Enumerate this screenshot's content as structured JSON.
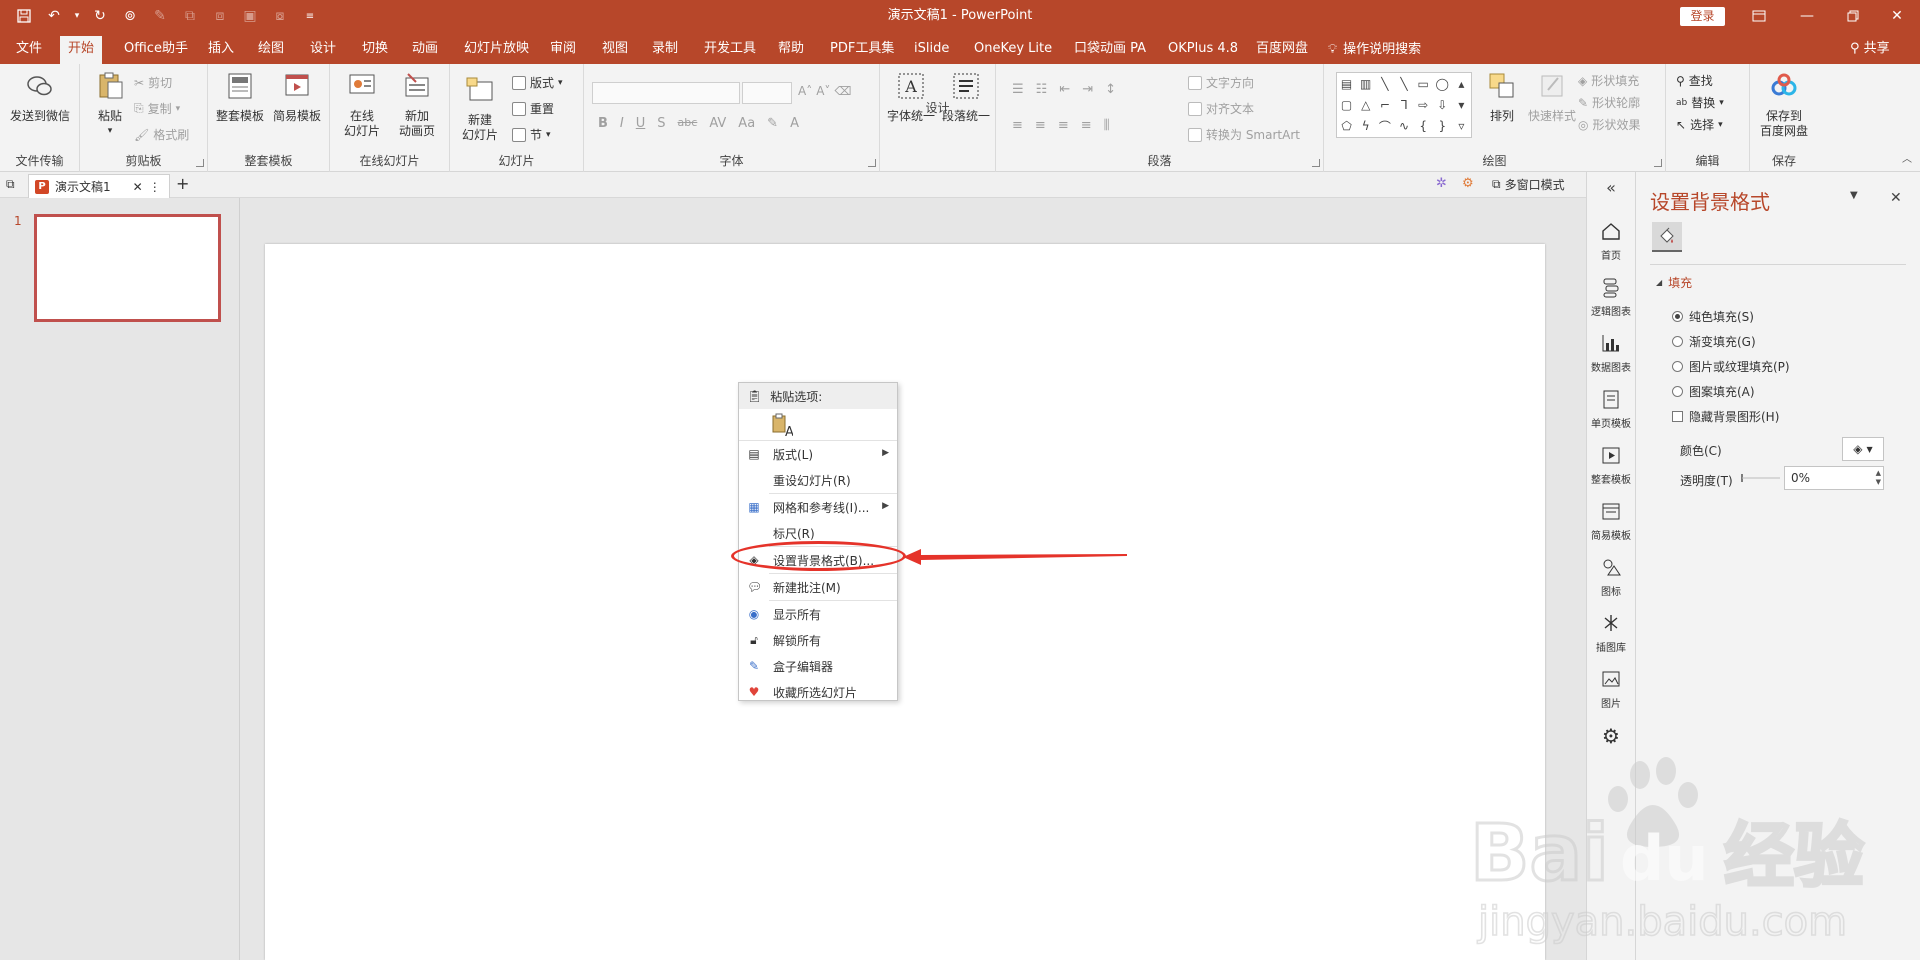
{
  "app": {
    "doc_title": "演示文稿1 - PowerPoint",
    "login": "登录"
  },
  "quick_access": {
    "icons": [
      "save-icon",
      "undo-icon",
      "redo-icon",
      "touch-mode-icon",
      "format-painter-icon",
      "group-icon",
      "ungroup-icon",
      "align-icon",
      "distribute-icon",
      "customize-qat-icon"
    ]
  },
  "tabs": [
    "文件",
    "开始",
    "Office助手",
    "插入",
    "绘图",
    "设计",
    "切换",
    "动画",
    "幻灯片放映",
    "审阅",
    "视图",
    "录制",
    "开发工具",
    "帮助",
    "PDF工具集",
    "iSlide",
    "OneKey Lite",
    "口袋动画 PA",
    "OKPlus 4.8",
    "百度网盘"
  ],
  "active_tab": "开始",
  "tell_me": "操作说明搜索",
  "share": "共享",
  "ribbon": {
    "groups": {
      "file_transfer": "文件传输",
      "clipboard": "剪贴板",
      "template_set": "整套模板",
      "online_slides": "在线幻灯片",
      "slides": "幻灯片",
      "font": "字体",
      "design": "设计",
      "paragraph": "段落",
      "drawing": "绘图",
      "editing": "编辑",
      "save": "保存"
    },
    "buttons": {
      "send_wechat": "发送到微信",
      "paste": "粘贴",
      "cut": "剪切",
      "copy": "复制",
      "format_painter": "格式刷",
      "full_template": "整套模板",
      "simple_template": "简易模板",
      "online_slide_1": "在线",
      "online_slide_2": "幻灯片",
      "new_anim_1": "新加",
      "new_anim_2": "动画页",
      "new_slide_1": "新建",
      "new_slide_2": "幻灯片",
      "layout": "版式",
      "reset": "重置",
      "section": "节",
      "font_unify": "字体统一",
      "para_unify": "段落统一",
      "text_direction": "文字方向",
      "align_text": "对齐文本",
      "to_smartart": "转换为 SmartArt",
      "arrange": "排列",
      "quick_styles": "快速样式",
      "shape_fill": "形状填充",
      "shape_outline": "形状轮廓",
      "shape_effects": "形状效果",
      "find": "查找",
      "replace": "替换",
      "select": "选择",
      "save_baidu_1": "保存到",
      "save_baidu_2": "百度网盘"
    },
    "font_format_glyphs": [
      "B",
      "I",
      "U",
      "S",
      "abc",
      "AV",
      "Aa",
      "A"
    ]
  },
  "doc_tab": {
    "name": "演示文稿1",
    "multi_window": "多窗口模式"
  },
  "thumbnails": [
    {
      "number": "1"
    }
  ],
  "context_menu": {
    "paste_header": "粘贴选项:",
    "items": [
      {
        "label": "版式(L)",
        "submenu": true,
        "icon": "layout-icon"
      },
      {
        "label": "重设幻灯片(R)",
        "submenu": false,
        "icon": ""
      },
      {
        "label": "网格和参考线(I)...",
        "submenu": true,
        "icon": "grid-icon"
      },
      {
        "label": "标尺(R)",
        "submenu": false,
        "icon": ""
      },
      {
        "label": "设置背景格式(B)...",
        "submenu": false,
        "icon": "format-background-icon"
      },
      {
        "label": "新建批注(M)",
        "submenu": false,
        "icon": "new-comment-icon"
      },
      {
        "label": "显示所有",
        "submenu": false,
        "icon": "eye-icon"
      },
      {
        "label": "解锁所有",
        "submenu": false,
        "icon": "unlock-icon"
      },
      {
        "label": "盒子编辑器",
        "submenu": false,
        "icon": "edit-icon"
      },
      {
        "label": "收藏所选幻灯片",
        "submenu": false,
        "icon": "heart-icon"
      }
    ]
  },
  "icon_strip": {
    "items": [
      "首页",
      "逻辑图表",
      "数据图表",
      "单页模板",
      "整套模板",
      "简易模板",
      "图标",
      "插图库",
      "图片"
    ]
  },
  "format_pane": {
    "title": "设置背景格式",
    "section": "填充",
    "options": [
      {
        "label": "纯色填充(S)",
        "type": "radio",
        "checked": true
      },
      {
        "label": "渐变填充(G)",
        "type": "radio",
        "checked": false
      },
      {
        "label": "图片或纹理填充(P)",
        "type": "radio",
        "checked": false
      },
      {
        "label": "图案填充(A)",
        "type": "radio",
        "checked": false
      },
      {
        "label": "隐藏背景图形(H)",
        "type": "checkbox",
        "checked": false
      }
    ],
    "color_label": "颜色(C)",
    "transparency_label": "透明度(T)",
    "transparency_value": "0%"
  },
  "watermark": {
    "brand": "Bai",
    "brand2": "du",
    "cn": "经验",
    "url": "jingyan.baidu.com"
  },
  "colors": {
    "accent": "#b7472a",
    "annotation": "#e5332a"
  }
}
